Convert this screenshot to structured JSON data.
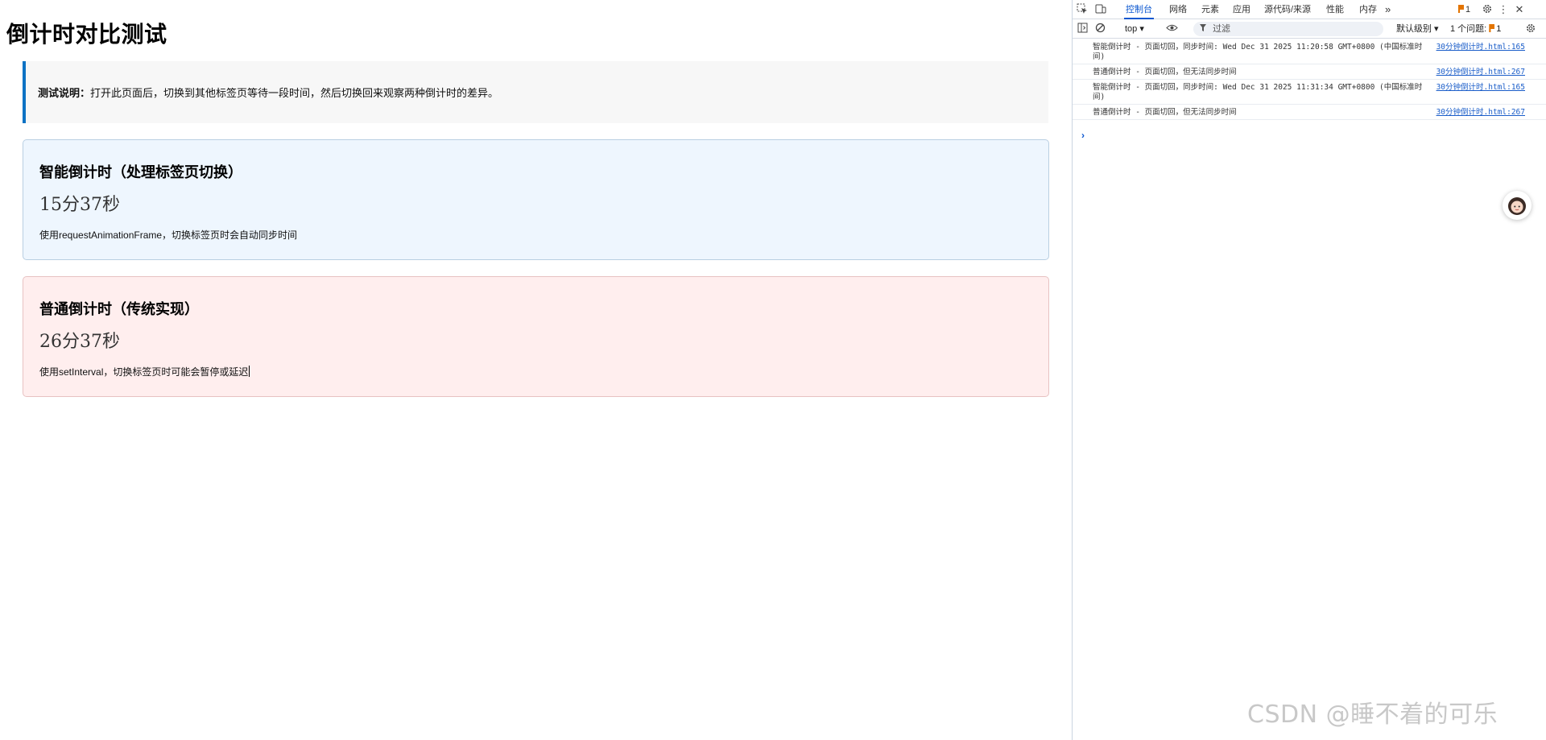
{
  "page": {
    "title": "倒计时对比测试",
    "note": {
      "label": "测试说明：",
      "text": "打开此页面后，切换到其他标签页等待一段时间，然后切换回来观察两种倒计时的差异。"
    },
    "cards": [
      {
        "title": "智能倒计时（处理标签页切换）",
        "time": "15分37秒",
        "desc": "使用requestAnimationFrame，切换标签页时会自动同步时间"
      },
      {
        "title": "普通倒计时（传统实现）",
        "time": "26分37秒",
        "desc": "使用setInterval，切换标签页时可能会暂停或延迟"
      }
    ]
  },
  "devtools": {
    "tabs": [
      "控制台",
      "网络",
      "元素",
      "应用",
      "源代码/来源",
      "性能",
      "内存"
    ],
    "active_tab": "控制台",
    "more_tabs": "»",
    "issue_badge": "1",
    "context": "top ▾",
    "filter_placeholder": "过滤",
    "level": "默认级别 ▾",
    "issues_label": "1 个问题:",
    "issues_count": "1",
    "logs": [
      {
        "message": "智能倒计时 - 页面切回，同步时间: Wed Dec 31 2025 11:20:58 GMT+0800 (中国标准时间)",
        "source": "30分钟倒计时.html:165"
      },
      {
        "message": "普通倒计时 - 页面切回，但无法同步时间",
        "source": "30分钟倒计时.html:267"
      },
      {
        "message": "智能倒计时 - 页面切回，同步时间: Wed Dec 31 2025 11:31:34 GMT+0800 (中国标准时间)",
        "source": "30分钟倒计时.html:165"
      },
      {
        "message": "普通倒计时 - 页面切回，但无法同步时间",
        "source": "30分钟倒计时.html:267"
      }
    ],
    "prompt": "›"
  },
  "watermark": "CSDN @睡不着的可乐",
  "colors": {
    "accent": "#0b72c4",
    "smart_bg": "#eef6fe",
    "normal_bg": "#ffeeee",
    "devtools_active": "#0b57d0"
  }
}
